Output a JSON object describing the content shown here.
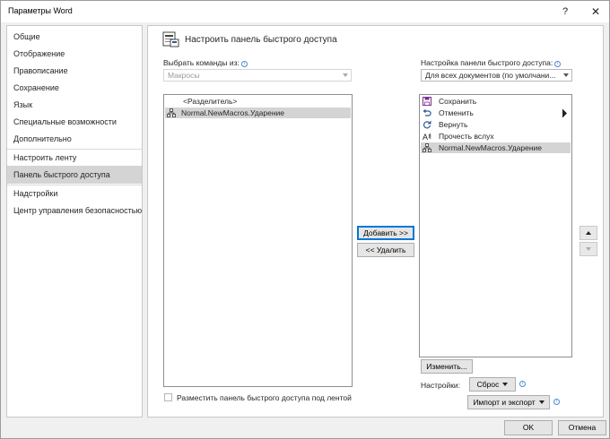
{
  "window": {
    "title": "Параметры Word",
    "help": "?",
    "close": "✕"
  },
  "sidebar": {
    "items": [
      {
        "label": "Общие"
      },
      {
        "label": "Отображение"
      },
      {
        "label": "Правописание"
      },
      {
        "label": "Сохранение"
      },
      {
        "label": "Язык"
      },
      {
        "label": "Специальные возможности"
      },
      {
        "label": "Дополнительно"
      },
      {
        "label": "Настроить ленту"
      },
      {
        "label": "Панель быстрого доступа",
        "selected": true
      },
      {
        "label": "Надстройки"
      },
      {
        "label": "Центр управления безопасностью"
      }
    ]
  },
  "main": {
    "heading": "Настроить панель быстрого доступа",
    "choose_label": "Выбрать команды из:",
    "choose_value": "Макросы",
    "customize_label": "Настройка панели быстрого доступа:",
    "customize_value": "Для всех документов (по умолчани...",
    "left_list": [
      {
        "label": "<Разделитель>",
        "icon": ""
      },
      {
        "label": "Normal.NewMacros.Ударение",
        "icon": "macro-icon",
        "selected": true
      }
    ],
    "right_list": [
      {
        "label": "Сохранить",
        "icon": "save-icon"
      },
      {
        "label": "Отменить",
        "icon": "undo-icon"
      },
      {
        "label": "Вернуть",
        "icon": "redo-icon"
      },
      {
        "label": "Прочесть вслух",
        "icon": "read-aloud-icon"
      },
      {
        "label": "Normal.NewMacros.Ударение",
        "icon": "macro-icon",
        "selected": true
      }
    ],
    "add_button": "Добавить >>",
    "remove_button": "<< Удалить",
    "modify_button": "Изменить...",
    "reset_label": "Настройки:",
    "reset_button": "Сброс",
    "import_export_button": "Импорт и экспорт",
    "checkbox_label": "Разместить панель быстрого доступа под лентой",
    "checkbox_checked": false
  },
  "footer": {
    "ok": "OK",
    "cancel": "Отмена"
  },
  "colors": {
    "selection": "#d4d4d4",
    "focus_border": "#0078d7",
    "info": "#4a8ad4",
    "panel_bg": "#f0f0f0"
  }
}
